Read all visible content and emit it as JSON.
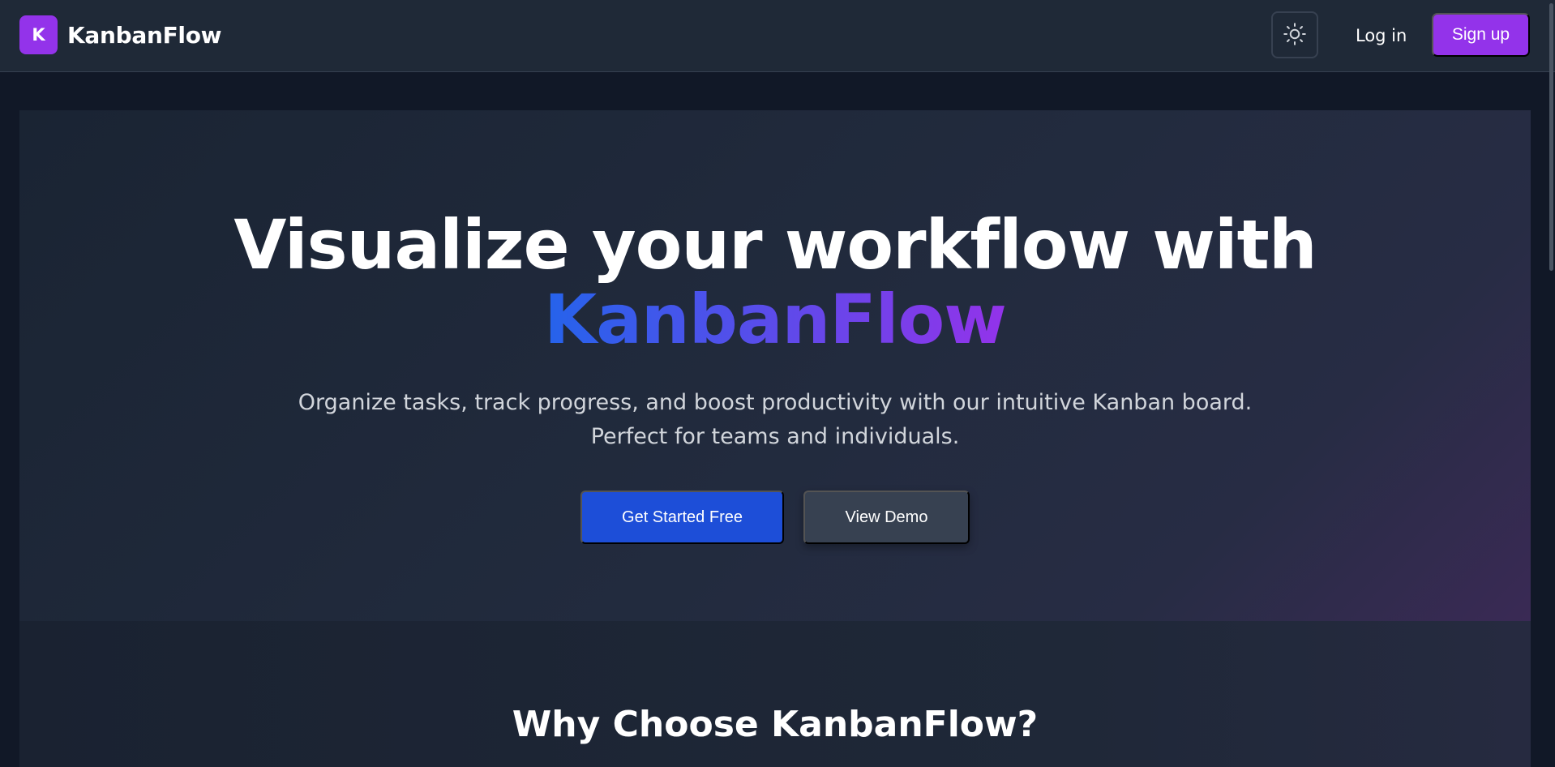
{
  "navbar": {
    "logo_letter": "K",
    "brand": "KanbanFlow",
    "theme_icon": "sun-icon",
    "login_label": "Log in",
    "signup_label": "Sign up"
  },
  "hero": {
    "title_line1": "Visualize your workflow with",
    "title_accent": "KanbanFlow",
    "subtitle_line1": "Organize tasks, track progress, and boost productivity with our intuitive Kanban board.",
    "subtitle_line2": "Perfect for teams and individuals.",
    "primary_cta": "Get Started Free",
    "secondary_cta": "View Demo"
  },
  "features": {
    "title": "Why Choose KanbanFlow?"
  },
  "colors": {
    "brand_purple": "#9333ea",
    "primary_blue": "#1d4ed8",
    "page_bg": "#111827",
    "nav_bg": "#1f2937"
  }
}
